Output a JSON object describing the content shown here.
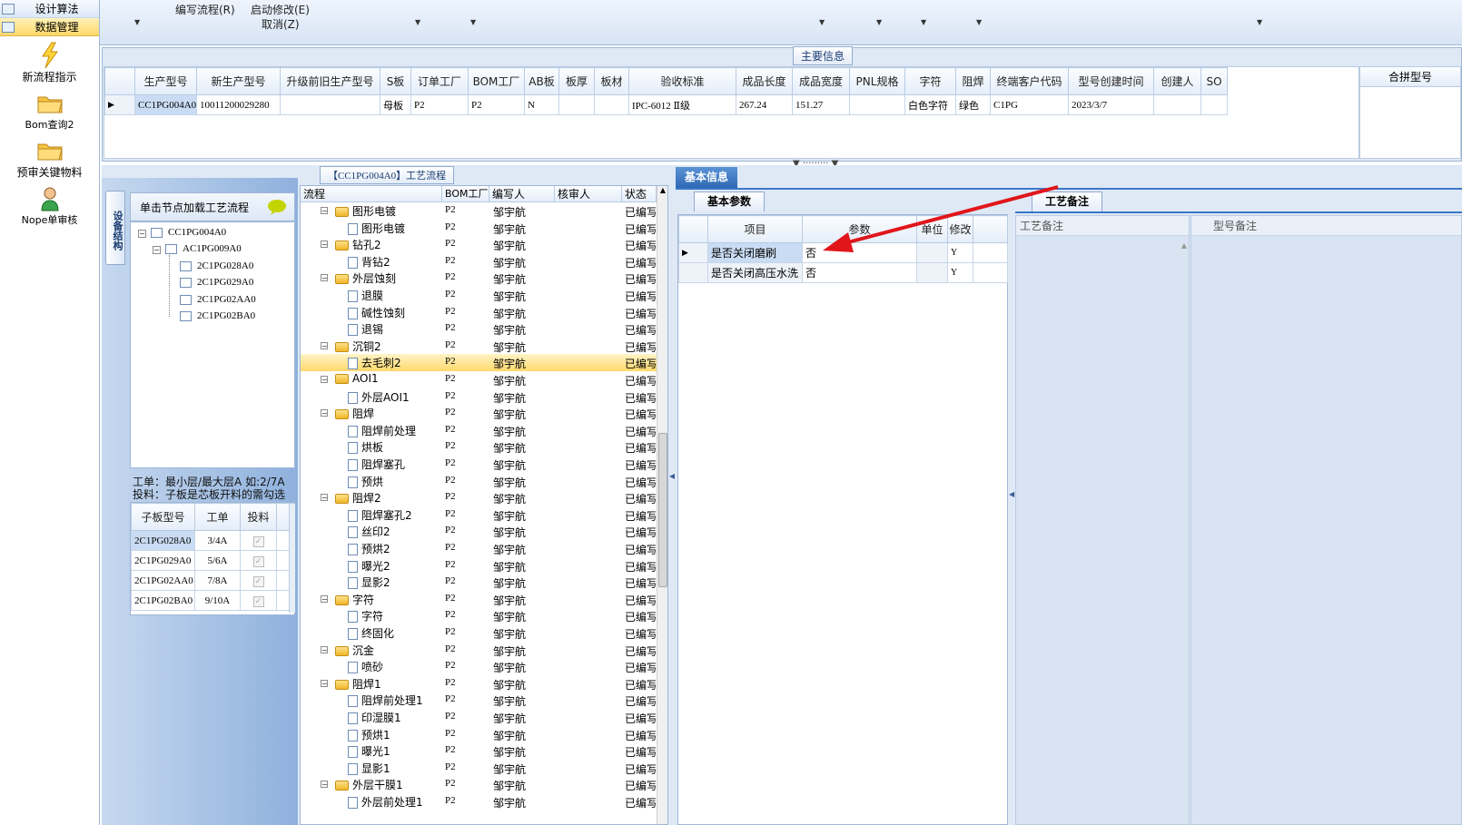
{
  "nav": {
    "top_items": [
      {
        "label": "设计算法"
      },
      {
        "label": "数据管理"
      }
    ],
    "buttons": [
      {
        "label": "新流程指示",
        "icon": "lightning-icon"
      },
      {
        "label": "Bom查询2",
        "icon": "folder-icon"
      },
      {
        "label": "预审关键物料",
        "icon": "folder-icon"
      },
      {
        "label": "Nope单审核",
        "icon": "user-icon"
      }
    ]
  },
  "toolbar": {
    "write_flow": "编写流程(R)",
    "start_modify": "启动修改(E)",
    "cancel": "取消(Z)"
  },
  "main_info": {
    "title": "主要信息",
    "columns": [
      "生产型号",
      "新生产型号",
      "升级前旧生产型号",
      "S板",
      "订单工厂",
      "BOM工厂",
      "AB板",
      "板厚",
      "板材",
      "验收标准",
      "成品长度",
      "成品宽度",
      "PNL规格",
      "字符",
      "阻焊",
      "终端客户代码",
      "型号创建时间",
      "创建人",
      "SO"
    ],
    "row": [
      "CC1PG004A0",
      "10011200029280",
      "",
      "母板",
      "P2",
      "P2",
      "N",
      "",
      "",
      "IPC-6012 Ⅱ级",
      "267.24",
      "151.27",
      "",
      "白色字符",
      "绿色",
      "C1PG",
      "2023/3/7",
      "",
      ""
    ],
    "merge_column": "合拼型号"
  },
  "structure": {
    "tab_label": "设备结构",
    "hint": "单击节点加载工艺流程",
    "tree": [
      {
        "label": "CC1PG004A0",
        "level": 0
      },
      {
        "label": "AC1PG009A0",
        "level": 1
      },
      {
        "label": "2C1PG028A0",
        "level": 2
      },
      {
        "label": "2C1PG029A0",
        "level": 2
      },
      {
        "label": "2C1PG02AA0",
        "level": 2
      },
      {
        "label": "2C1PG02BA0",
        "level": 2
      }
    ],
    "note1": "工单：最小层/最大层A 如:2/7A",
    "note2": "投料：子板是芯板开料的需勾选",
    "sub_columns": [
      "子板型号",
      "工单",
      "投料"
    ],
    "sub_rows": [
      {
        "model": "2C1PG028A0",
        "order": "3/4A",
        "feed": true
      },
      {
        "model": "2C1PG029A0",
        "order": "5/6A",
        "feed": true
      },
      {
        "model": "2C1PG02AA0",
        "order": "7/8A",
        "feed": true
      },
      {
        "model": "2C1PG02BA0",
        "order": "9/10A",
        "feed": true
      }
    ]
  },
  "flow": {
    "title": "【CC1PG004A0】工艺流程",
    "columns": [
      "流程",
      "BOM工厂",
      "编写人",
      "核审人",
      "状态"
    ],
    "rows": [
      {
        "name": "图形电镀",
        "type": "folder",
        "bom": "P2",
        "writer": "邹宇航",
        "status": "已编写"
      },
      {
        "name": "图形电镀",
        "type": "doc",
        "bom": "P2",
        "writer": "邹宇航",
        "status": "已编写"
      },
      {
        "name": "钻孔2",
        "type": "folder",
        "bom": "P2",
        "writer": "邹宇航",
        "status": "已编写"
      },
      {
        "name": "背钻2",
        "type": "doc",
        "bom": "P2",
        "writer": "邹宇航",
        "status": "已编写"
      },
      {
        "name": "外层蚀刻",
        "type": "folder",
        "bom": "P2",
        "writer": "邹宇航",
        "status": "已编写"
      },
      {
        "name": "退膜",
        "type": "doc",
        "bom": "P2",
        "writer": "邹宇航",
        "status": "已编写"
      },
      {
        "name": "碱性蚀刻",
        "type": "doc",
        "bom": "P2",
        "writer": "邹宇航",
        "status": "已编写"
      },
      {
        "name": "退锡",
        "type": "doc",
        "bom": "P2",
        "writer": "邹宇航",
        "status": "已编写"
      },
      {
        "name": "沉铜2",
        "type": "folder",
        "bom": "P2",
        "writer": "邹宇航",
        "status": "已编写"
      },
      {
        "name": "去毛刺2",
        "type": "doc",
        "bom": "P2",
        "writer": "邹宇航",
        "status": "已编写",
        "selected": true
      },
      {
        "name": "AOI1",
        "type": "folder",
        "bom": "P2",
        "writer": "邹宇航",
        "status": "已编写"
      },
      {
        "name": "外层AOI1",
        "type": "doc",
        "bom": "P2",
        "writer": "邹宇航",
        "status": "已编写"
      },
      {
        "name": "阻焊",
        "type": "folder",
        "bom": "P2",
        "writer": "邹宇航",
        "status": "已编写"
      },
      {
        "name": "阻焊前处理",
        "type": "doc",
        "bom": "P2",
        "writer": "邹宇航",
        "status": "已编写"
      },
      {
        "name": "烘板",
        "type": "doc",
        "bom": "P2",
        "writer": "邹宇航",
        "status": "已编写"
      },
      {
        "name": "阻焊塞孔",
        "type": "doc",
        "bom": "P2",
        "writer": "邹宇航",
        "status": "已编写"
      },
      {
        "name": "预烘",
        "type": "doc",
        "bom": "P2",
        "writer": "邹宇航",
        "status": "已编写"
      },
      {
        "name": "阻焊2",
        "type": "folder",
        "bom": "P2",
        "writer": "邹宇航",
        "status": "已编写"
      },
      {
        "name": "阻焊塞孔2",
        "type": "doc",
        "bom": "P2",
        "writer": "邹宇航",
        "status": "已编写"
      },
      {
        "name": "丝印2",
        "type": "doc",
        "bom": "P2",
        "writer": "邹宇航",
        "status": "已编写"
      },
      {
        "name": "预烘2",
        "type": "doc",
        "bom": "P2",
        "writer": "邹宇航",
        "status": "已编写"
      },
      {
        "name": "曝光2",
        "type": "doc",
        "bom": "P2",
        "writer": "邹宇航",
        "status": "已编写"
      },
      {
        "name": "显影2",
        "type": "doc",
        "bom": "P2",
        "writer": "邹宇航",
        "status": "已编写"
      },
      {
        "name": "字符",
        "type": "folder",
        "bom": "P2",
        "writer": "邹宇航",
        "status": "已编写"
      },
      {
        "name": "字符",
        "type": "doc",
        "bom": "P2",
        "writer": "邹宇航",
        "status": "已编写"
      },
      {
        "name": "终固化",
        "type": "doc",
        "bom": "P2",
        "writer": "邹宇航",
        "status": "已编写"
      },
      {
        "name": "沉金",
        "type": "folder",
        "bom": "P2",
        "writer": "邹宇航",
        "status": "已编写"
      },
      {
        "name": "喷砂",
        "type": "doc",
        "bom": "P2",
        "writer": "邹宇航",
        "status": "已编写"
      },
      {
        "name": "阻焊1",
        "type": "folder",
        "bom": "P2",
        "writer": "邹宇航",
        "status": "已编写"
      },
      {
        "name": "阻焊前处理1",
        "type": "doc",
        "bom": "P2",
        "writer": "邹宇航",
        "status": "已编写"
      },
      {
        "name": "印湿膜1",
        "type": "doc",
        "bom": "P2",
        "writer": "邹宇航",
        "status": "已编写"
      },
      {
        "name": "预烘1",
        "type": "doc",
        "bom": "P2",
        "writer": "邹宇航",
        "status": "已编写"
      },
      {
        "name": "曝光1",
        "type": "doc",
        "bom": "P2",
        "writer": "邹宇航",
        "status": "已编写"
      },
      {
        "name": "显影1",
        "type": "doc",
        "bom": "P2",
        "writer": "邹宇航",
        "status": "已编写"
      },
      {
        "name": "外层干膜1",
        "type": "folder",
        "bom": "P2",
        "writer": "邹宇航",
        "status": "已编写"
      },
      {
        "name": "外层前处理1",
        "type": "doc",
        "bom": "P2",
        "writer": "邹宇航",
        "status": "已编写"
      }
    ]
  },
  "basic_info": {
    "tab": "基本信息",
    "subtab": "基本参数",
    "columns": [
      "项目",
      "参数",
      "单位",
      "修改"
    ],
    "rows": [
      {
        "item": "是否关闭磨刷",
        "value": "否",
        "unit": "",
        "modify": "Y"
      },
      {
        "item": "是否关闭高压水洗",
        "value": "否",
        "unit": "",
        "modify": "Y"
      }
    ]
  },
  "process_note": {
    "tab": "工艺备注",
    "columns": [
      "工艺备注",
      "型号备注"
    ]
  },
  "colors": {
    "accent": "#3a78c8",
    "selection": "#ffd86b",
    "panel": "#dfe9f6",
    "arrow": "#e0161b"
  }
}
